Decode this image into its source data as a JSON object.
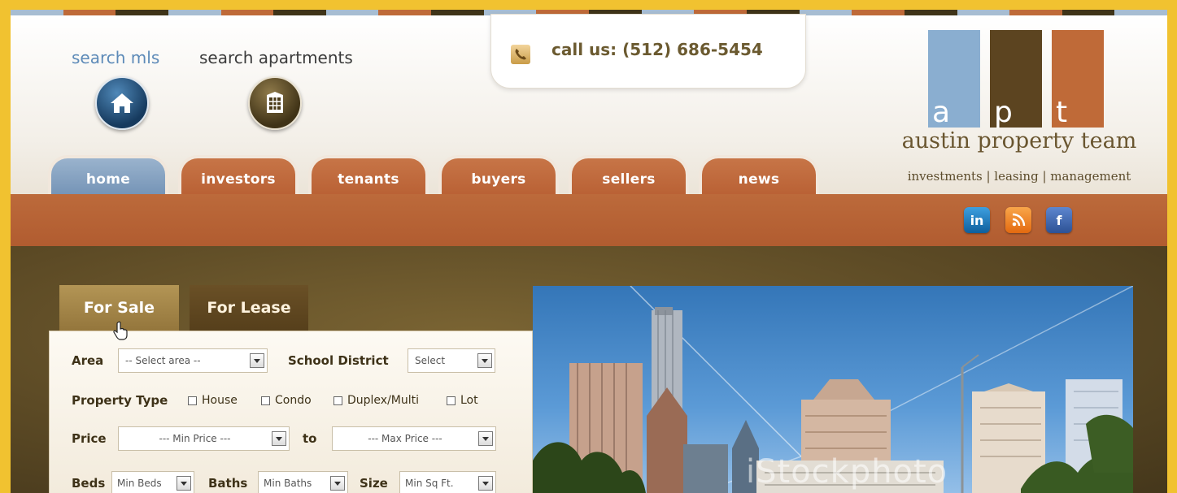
{
  "brand": {
    "stripe_colors": [
      "#a7bdd2",
      "#bf6a38",
      "#3f3418"
    ],
    "blue": "#6f8fb3",
    "orange": "#b75e32",
    "brown": "#5c4a25"
  },
  "header": {
    "search_mls": "search mls",
    "search_apartments": "search apartments",
    "home_icon": "house-icon",
    "apartments_icon": "building-icon",
    "call": "call us: (512) 686-5454",
    "phone_icon": "phone-icon"
  },
  "logo": {
    "letters": [
      "a",
      "p",
      "t"
    ],
    "block_colors": [
      "#8aaed0",
      "#5c4420",
      "#bf6a38"
    ],
    "name": "austin property team",
    "tagline": "investments | leasing | management"
  },
  "nav": {
    "tabs": [
      "home",
      "investors",
      "tenants",
      "buyers",
      "sellers",
      "news"
    ],
    "active": "home"
  },
  "social": {
    "linkedin": "in",
    "rss_icon": "rss-icon",
    "facebook": "f"
  },
  "search_form": {
    "tabs": {
      "sale": "For Sale",
      "lease": "For Lease"
    },
    "area": {
      "label": "Area",
      "value": "-- Select area --"
    },
    "school": {
      "label": "School District",
      "value": "Select"
    },
    "property_type": {
      "label": "Property Type",
      "options": [
        "House",
        "Condo",
        "Duplex/Multi",
        "Lot"
      ]
    },
    "price": {
      "label": "Price",
      "min": "--- Min Price ---",
      "to": "to",
      "max": "--- Max Price ---"
    },
    "beds": {
      "label": "Beds",
      "value": "Min Beds"
    },
    "baths": {
      "label": "Baths",
      "value": "Min Baths"
    },
    "size": {
      "label": "Size",
      "value": "Min Sq Ft."
    }
  },
  "photo": {
    "watermark": "iStockphoto"
  }
}
